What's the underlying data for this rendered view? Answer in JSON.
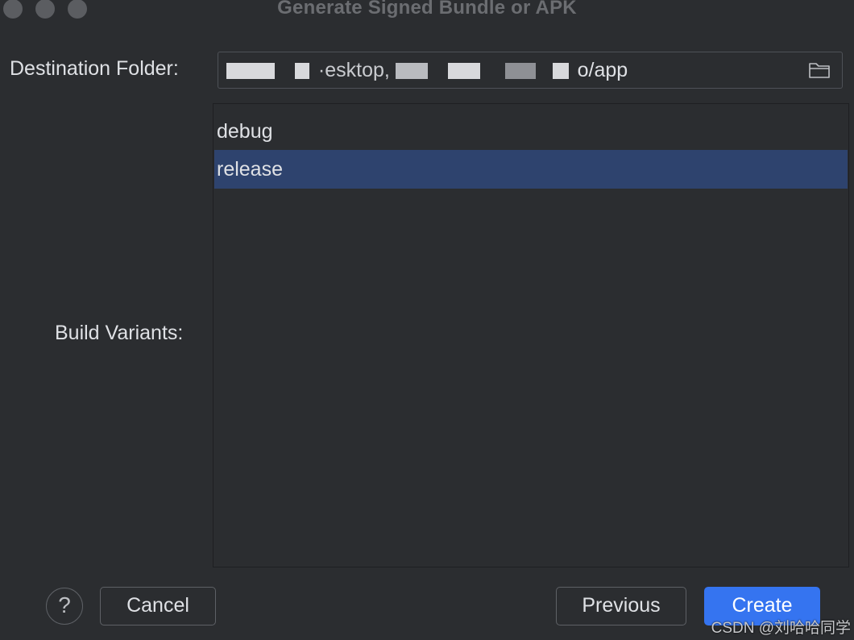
{
  "window": {
    "title": "Generate Signed Bundle or APK",
    "traffic_lights": [
      "close",
      "minimize",
      "zoom"
    ]
  },
  "destination": {
    "label": "Destination Folder:",
    "value_suffix": "o/app",
    "value_partial": "·esktop,",
    "icon": "folder-icon"
  },
  "build_variants": {
    "label": "Build Variants:",
    "items": [
      {
        "label": "debug",
        "selected": false
      },
      {
        "label": "release",
        "selected": true
      }
    ]
  },
  "buttons": {
    "help": "?",
    "cancel": "Cancel",
    "previous": "Previous",
    "create": "Create"
  },
  "colors": {
    "background": "#2b2d30",
    "selection": "#2e436e",
    "primary_button": "#3574f0",
    "text": "#dfe1e5"
  },
  "watermark": "CSDN @刘哈哈同学"
}
